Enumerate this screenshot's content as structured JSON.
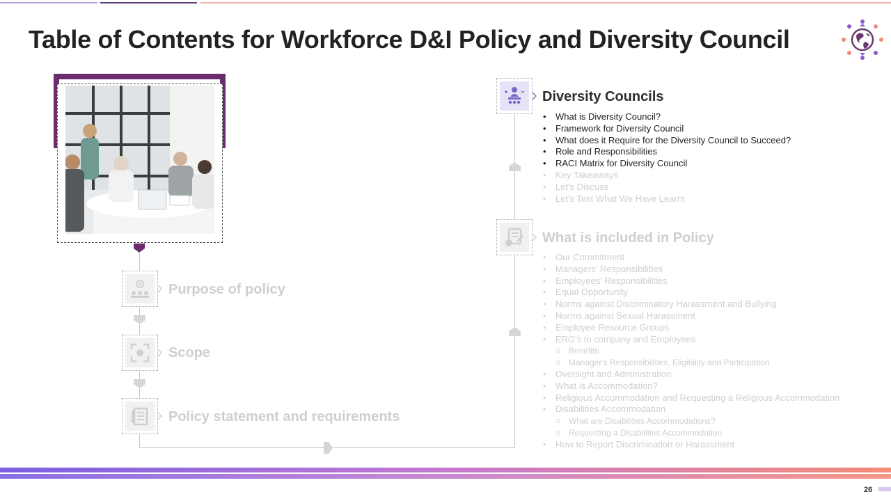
{
  "title": "Table of Contents for Workforce D&I Policy and Diversity Council",
  "colors": {
    "accent": "#6b2d6e",
    "faint_text": "#cfcfcf",
    "bar_start": "#7a5ae0",
    "bar_end": "#f48a7a"
  },
  "left_sections": [
    {
      "label": "Purpose of policy",
      "icon": "gear-people-icon"
    },
    {
      "label": "Scope",
      "icon": "focus-target-icon"
    },
    {
      "label": "Policy statement and requirements",
      "icon": "document-list-icon"
    }
  ],
  "diversity_councils": {
    "title": "Diversity Councils",
    "icon": "council-meeting-icon",
    "active_items": [
      "What is Diversity Council?",
      "Framework for Diversity Council",
      "What does it Require for the Diversity Council to Succeed?",
      "Role and Responsibilities",
      "RACI Matrix for Diversity Council"
    ],
    "faded_items": [
      "Key Takeaways",
      "Let's Discuss",
      "Let's Test What We Have Learnt"
    ]
  },
  "policy": {
    "title": "What is included in Policy",
    "icon": "policy-checklist-icon",
    "items": [
      {
        "text": "Our Commitment"
      },
      {
        "text": "Managers' Responsibilities"
      },
      {
        "text": "Employees' Responsibilities"
      },
      {
        "text": "Equal Opportunity"
      },
      {
        "text": "Norms against Discriminatory Harassment and Bullying"
      },
      {
        "text": "Norms against Sexual Harassment"
      },
      {
        "text": "Employee Resource Groups"
      },
      {
        "text": "ERG's to company and Employees"
      },
      {
        "text": "Benefits",
        "sub": true
      },
      {
        "text": "Manager's Responsibilities, Eligibility and Participation",
        "sub": true
      },
      {
        "text": "Oversight and Administration"
      },
      {
        "text": "What is Accommodation?"
      },
      {
        "text": "Religious Accommodation and Requesting a Religious Accommodation"
      },
      {
        "text": "Disabilities Accommodation"
      },
      {
        "text": "What are Disabilities Accommodations?",
        "sub": true
      },
      {
        "text": "Requesting a Disabilities Accommodation",
        "sub": true
      },
      {
        "text": "How to Report Discrimination or Harassment"
      }
    ]
  },
  "page_number": "26"
}
